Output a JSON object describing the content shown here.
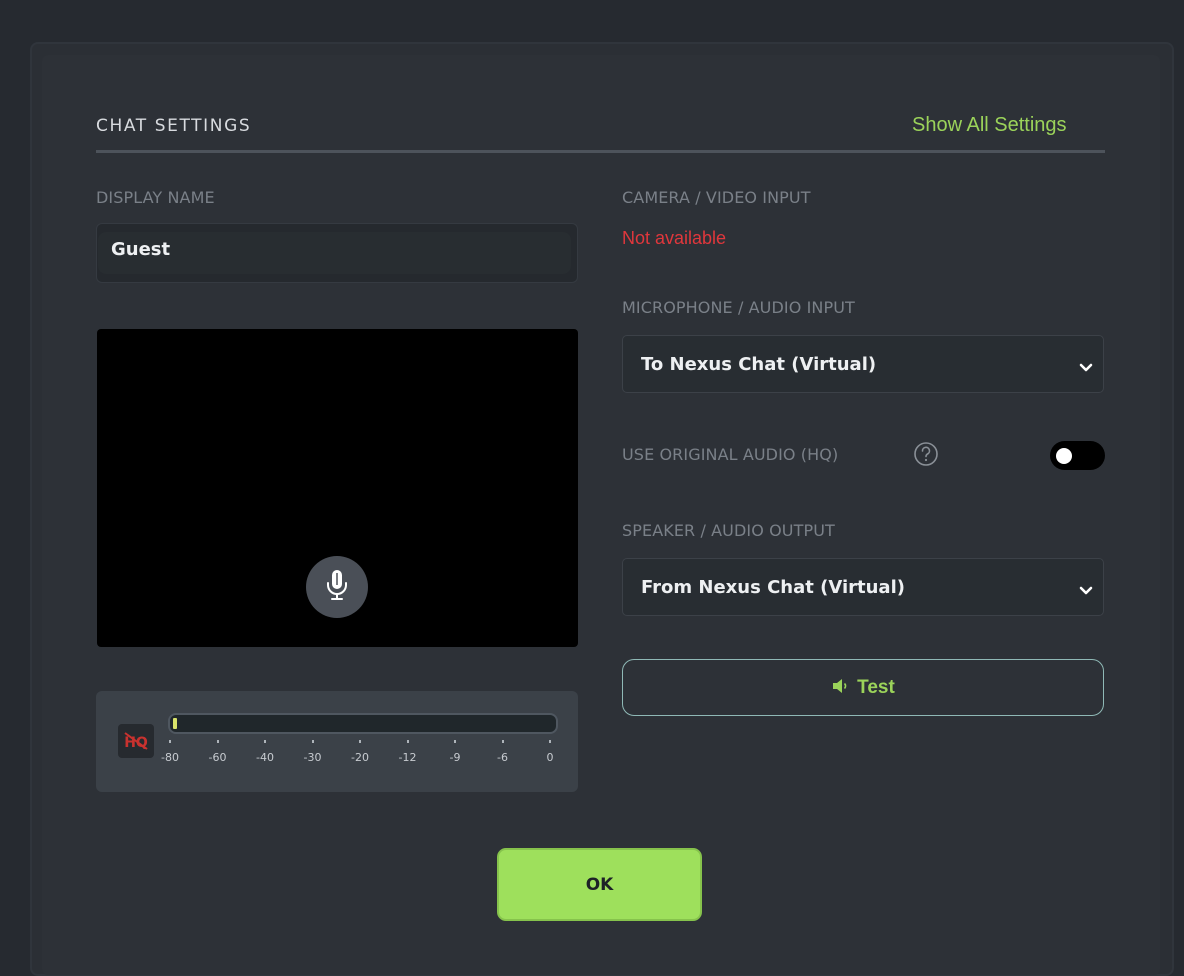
{
  "header": {
    "title": "CHAT SETTINGS",
    "show_all_label": "Show All Settings"
  },
  "display_name": {
    "label": "DISPLAY NAME",
    "value": "Guest"
  },
  "camera": {
    "label": "CAMERA / VIDEO INPUT",
    "status": "Not available"
  },
  "microphone": {
    "label": "MICROPHONE / AUDIO INPUT",
    "selected": "To Nexus Chat (Virtual)"
  },
  "original_audio": {
    "label": "USE ORIGINAL AUDIO (HQ)",
    "enabled": false
  },
  "speaker": {
    "label": "SPEAKER / AUDIO OUTPUT",
    "selected": "From Nexus Chat (Virtual)"
  },
  "test_button": {
    "label": "Test"
  },
  "meter": {
    "ticks": [
      "-80",
      "-60",
      "-40",
      "-30",
      "-20",
      "-12",
      "-9",
      "-6",
      "0"
    ],
    "level_fraction": 0.01
  },
  "ok_button": {
    "label": "OK"
  },
  "colors": {
    "accent": "#9bd35a",
    "error": "#e0373c",
    "ok_button": "#9ee05c"
  },
  "icons": {
    "mic": "microphone-icon",
    "hq": "hq-disabled-icon",
    "help": "help-circle-icon",
    "chevron": "chevron-down-icon",
    "speaker": "speaker-icon"
  }
}
